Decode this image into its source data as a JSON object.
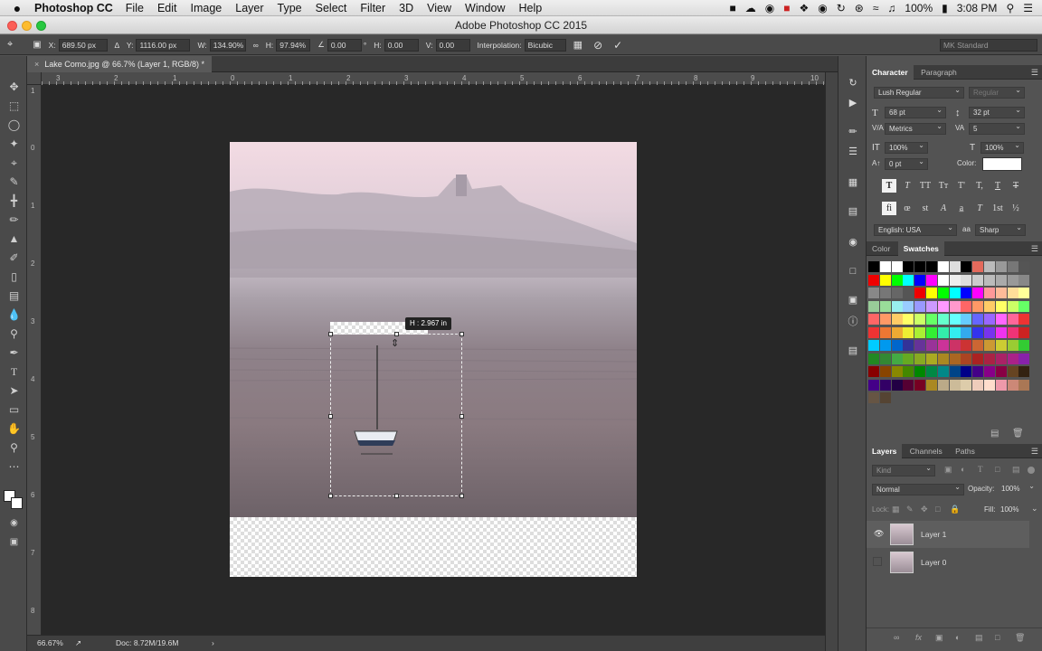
{
  "menubar": {
    "apple": "",
    "app_name": "Photoshop CC",
    "items": [
      "File",
      "Edit",
      "Image",
      "Layer",
      "Type",
      "Select",
      "Filter",
      "3D",
      "View",
      "Window",
      "Help"
    ],
    "battery": "100%",
    "time": "3:08 PM"
  },
  "window": {
    "title": "Adobe Photoshop CC 2015"
  },
  "options": {
    "x_label": "X:",
    "x_value": "689.50 px",
    "y_label": "Y:",
    "y_value": "1116.00 px",
    "w_label": "W:",
    "w_value": "134.90%",
    "h_label": "H:",
    "h_value": "97.94%",
    "angle_value": "0.00",
    "angle_unit": "°",
    "hskew_label": "H:",
    "hskew_value": "0.00",
    "vskew_label": "V:",
    "vskew_value": "0.00",
    "interpolation_label": "Interpolation:",
    "interpolation_value": "Bicubic",
    "workspace": "MK Standard"
  },
  "document": {
    "tab_title": "Lake Como.jpg @ 66.7% (Layer 1, RGB/8) *",
    "tooltip": "H : 2.967 in",
    "ruler_h": [
      "3",
      "2",
      "1",
      "0",
      "1",
      "2",
      "3",
      "4",
      "5",
      "6",
      "7",
      "8",
      "9",
      "10"
    ],
    "ruler_v": [
      "1",
      "0",
      "1",
      "2",
      "3",
      "4",
      "5",
      "6",
      "7",
      "8"
    ]
  },
  "status": {
    "zoom": "66.67%",
    "doc": "Doc: 8.72M/19.6M"
  },
  "character": {
    "tab_character": "Character",
    "tab_paragraph": "Paragraph",
    "font_family": "Lush Regular",
    "font_style": "Regular",
    "font_size": "68 pt",
    "leading": "32 pt",
    "kerning": "Metrics",
    "tracking": "5",
    "vscale": "100%",
    "hscale": "100%",
    "baseline": "0 pt",
    "color_label": "Color:",
    "language": "English: USA",
    "antialias_icon": "aa",
    "antialias": "Sharp"
  },
  "swatches": {
    "tab_color": "Color",
    "tab_swatches": "Swatches"
  },
  "layers": {
    "tab_layers": "Layers",
    "tab_channels": "Channels",
    "tab_paths": "Paths",
    "kind": "Kind",
    "blend": "Normal",
    "opacity_label": "Opacity:",
    "opacity": "100%",
    "lock_label": "Lock:",
    "fill_label": "Fill:",
    "fill": "100%",
    "items": [
      {
        "name": "Layer 1",
        "visible": true,
        "selected": true
      },
      {
        "name": "Layer 0",
        "visible": false,
        "selected": false
      }
    ]
  },
  "colors": {
    "accent": "#2e72d8",
    "panel": "#535353",
    "canvas_bg": "#282828"
  }
}
